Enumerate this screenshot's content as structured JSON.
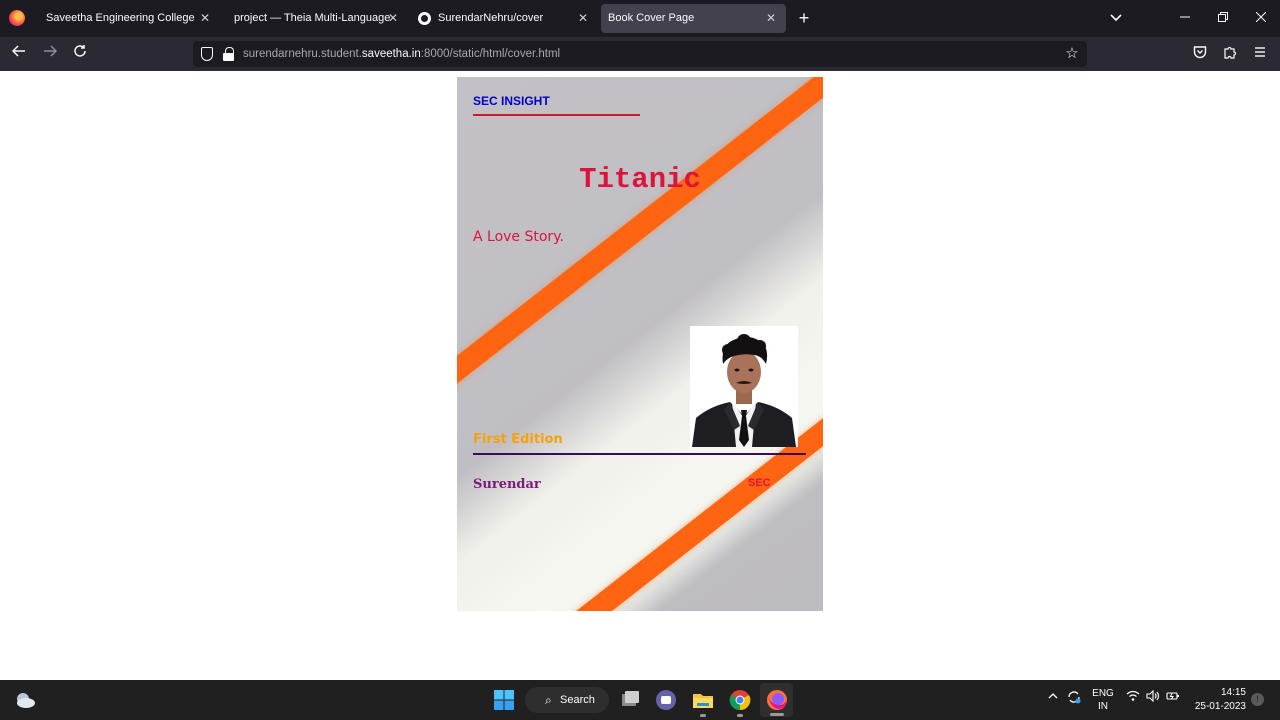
{
  "browser": {
    "tabs": [
      {
        "label": "Saveetha Engineering College",
        "icon": "firefox-icon",
        "active": false
      },
      {
        "label": "project — Theia Multi-Language Ex",
        "icon": "none",
        "active": false
      },
      {
        "label": "SurendarNehru/cover",
        "icon": "github-icon",
        "active": false
      },
      {
        "label": "Book Cover Page",
        "icon": "none",
        "active": true
      }
    ],
    "close_glyph": "✕",
    "new_tab_glyph": "+",
    "url": {
      "prefix": "surendarnehru.student.",
      "domain": "saveetha.in",
      "suffix": ":8000/static/html/cover.html"
    }
  },
  "cover": {
    "brand": "SEC INSIGHT",
    "title": "Titanic",
    "subtitle": "A Love Story.",
    "edition": "First Edition",
    "author": "Surendar",
    "publisher": "SEC",
    "colors": {
      "stripe": "#ff6510",
      "title": "#dc143c",
      "brand": "#0000cc",
      "edition": "#f5a20a",
      "author": "#7a1a7a"
    }
  },
  "taskbar": {
    "search_label": "Search",
    "lang_line1": "ENG",
    "lang_line2": "IN",
    "time": "14:15",
    "date": "25-01-2023"
  }
}
